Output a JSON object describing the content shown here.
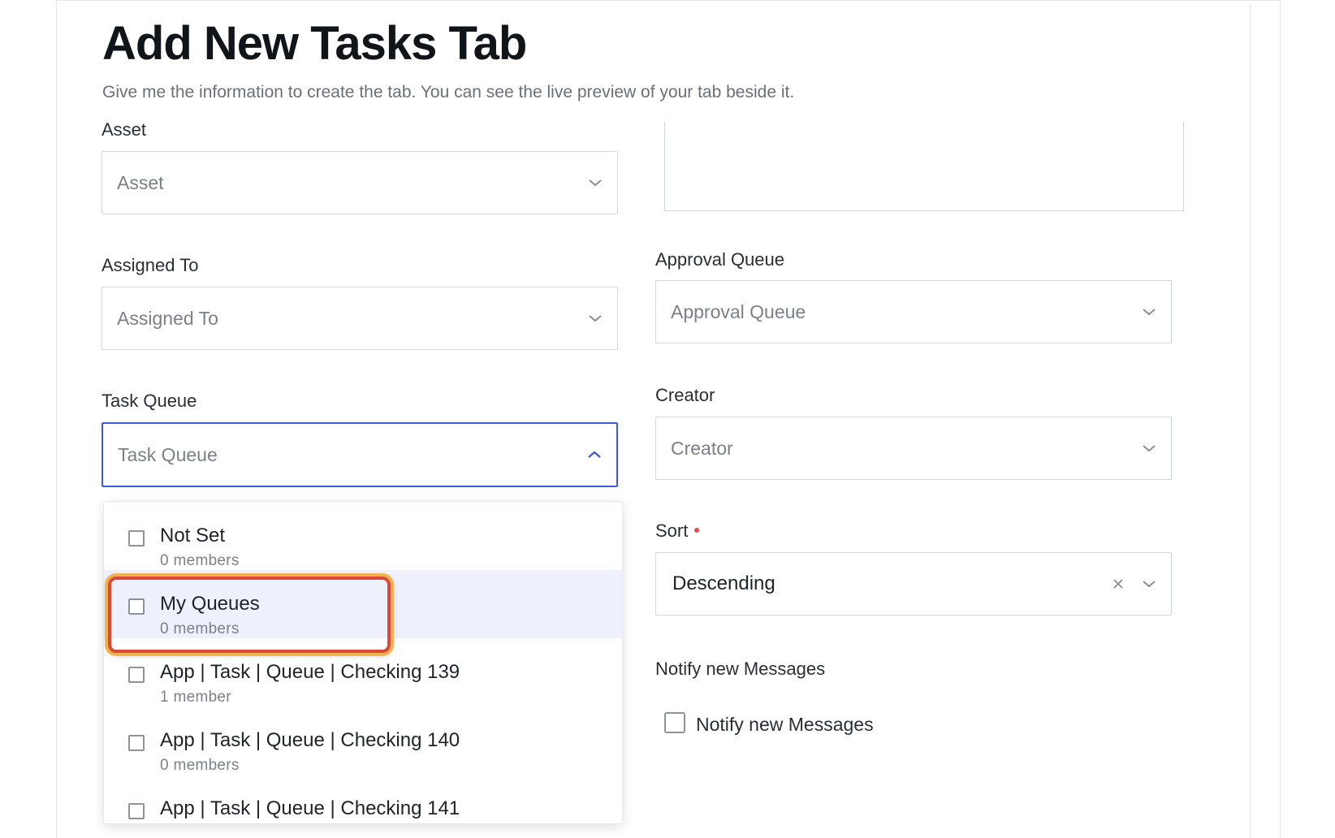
{
  "page": {
    "title": "Add New Tasks Tab",
    "subtitle": "Give me the information to create the tab. You can see the live preview of your tab beside it."
  },
  "fields": {
    "asset": {
      "label": "Asset",
      "placeholder": "Asset"
    },
    "assigned_to": {
      "label": "Assigned To",
      "placeholder": "Assigned To"
    },
    "task_queue": {
      "label": "Task Queue",
      "placeholder": "Task Queue",
      "expanded": true
    },
    "approval_queue": {
      "label": "Approval Queue",
      "placeholder": "Approval Queue"
    },
    "creator": {
      "label": "Creator",
      "placeholder": "Creator"
    },
    "sort": {
      "label": "Sort",
      "value": "Descending",
      "required": true
    },
    "notify": {
      "label": "Notify new Messages",
      "checkbox_label": "Notify new Messages",
      "checked": false
    }
  },
  "task_queue_options": [
    {
      "name": "Not Set",
      "members": "0 members",
      "checked": false
    },
    {
      "name": "My Queues",
      "members": "0 members",
      "checked": false,
      "highlighted": true
    },
    {
      "name": "App | Task | Queue | Checking 139",
      "members": "1 member",
      "checked": false
    },
    {
      "name": "App | Task | Queue | Checking 140",
      "members": "0 members",
      "checked": false
    },
    {
      "name": "App | Task | Queue | Checking 141",
      "members": "",
      "checked": false
    }
  ],
  "colors": {
    "focus_border": "#3f5bd6",
    "highlight_row": "#eef0fb",
    "annotation_outer": "#f3b24e",
    "annotation_inner": "#d94a3b",
    "required_dot": "#e5484d"
  },
  "icons": {
    "dropdown": "chevron-down-icon",
    "dropdown_open": "chevron-up-icon",
    "clear": "close-icon"
  }
}
